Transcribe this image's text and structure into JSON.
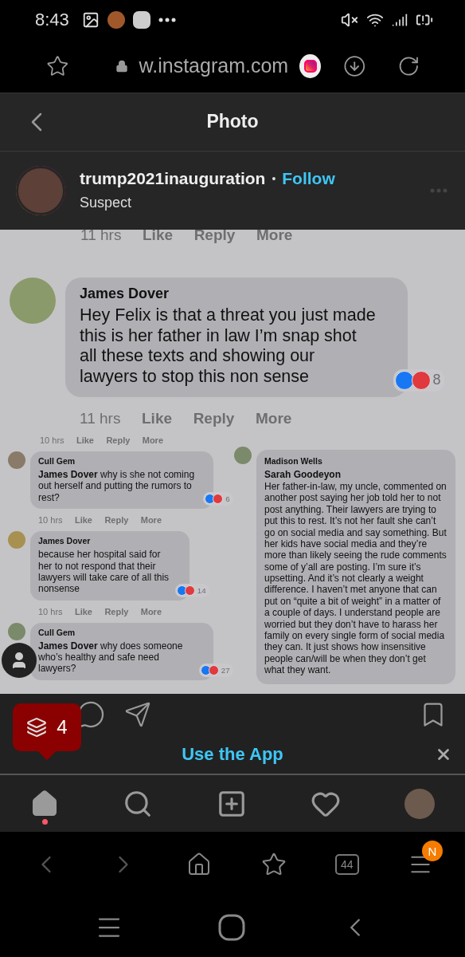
{
  "status_bar": {
    "time": "8:43"
  },
  "browser": {
    "url": "w.instagram.com",
    "tab_count": "44",
    "menu_badge": "N"
  },
  "header": {
    "title": "Photo"
  },
  "post": {
    "username": "trump2021inauguration",
    "separator": "•",
    "follow": "Follow",
    "subtitle": "Suspect"
  },
  "photo": {
    "top_meta": {
      "time": "11 hrs",
      "actions": [
        "Like",
        "Reply",
        "More"
      ]
    },
    "main_comment": {
      "author": "James Dover",
      "text": "Hey Felix is that a threat you just made this is her father in law I’m snap shot all these texts and showing our lawyers to stop this non sense",
      "count": "8",
      "meta": {
        "time": "11 hrs",
        "actions": [
          "Like",
          "Reply",
          "More"
        ]
      }
    },
    "left_top_meta": {
      "time": "10 hrs",
      "actions": [
        "Like",
        "Reply",
        "More"
      ]
    },
    "left_comments": [
      {
        "author": "Cull Gem",
        "text": "**James Dover** why is she not coming out herself and putting the rumors to rest?",
        "count": "6",
        "meta": {
          "time": "10 hrs",
          "actions": [
            "Like",
            "Reply",
            "More"
          ]
        }
      },
      {
        "author": "James Dover",
        "text": "because her hospital said for her to not respond that their lawyers will take care of all this nonsense",
        "count": "14",
        "meta": {
          "time": "10 hrs",
          "actions": [
            "Like",
            "Reply",
            "More"
          ]
        }
      },
      {
        "author": "Cull Gem",
        "text": "**James Dover** why does someone who’s healthy and safe need lawyers?",
        "count": "27"
      }
    ],
    "right_comments": [
      {
        "author": "Madison Wells",
        "mention": "Sarah Goodeyon",
        "text": "Her father-in-law, my uncle, commented on another post saying her job told her to not post anything. Their lawyers are trying to put this to rest. It’s not her fault she can’t go on social media and say something. But her kids have social media and they’re more than likely seeing the rude comments some of y’all are posting. I’m sure it’s upsetting. And it’s not clearly a weight difference. I haven’t met anyone that can put on “quite a bit of weight” in a matter of a couple of days. I understand people are worried but they don’t have to harass her family on every single form of social media they can. It just shows how insensitive people can/will be when they don’t get what they want."
      }
    ]
  },
  "tabs_badge": "4",
  "banner": {
    "label": "Use the App"
  },
  "bottom_nav": [
    {
      "kind": "home",
      "selected": true,
      "dot": true
    },
    {
      "kind": "search",
      "selected": false,
      "dot": false
    },
    {
      "kind": "add",
      "selected": false,
      "dot": false
    },
    {
      "kind": "activity",
      "selected": false,
      "dot": false
    },
    {
      "kind": "profile",
      "selected": false,
      "dot": false
    }
  ]
}
